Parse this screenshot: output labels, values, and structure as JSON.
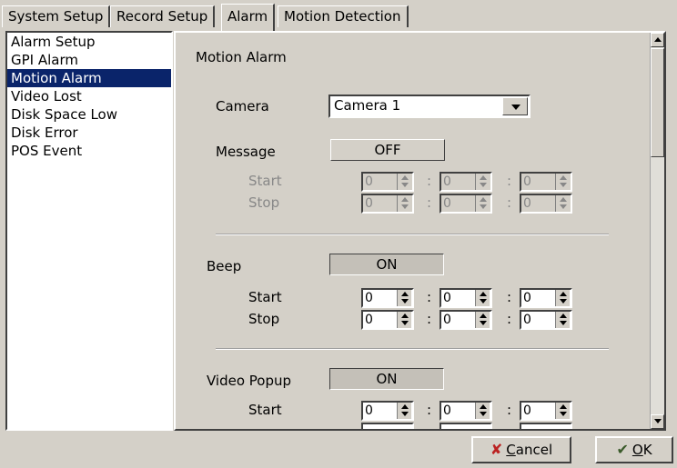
{
  "tabs": [
    {
      "label": "System Setup"
    },
    {
      "label": "Record Setup"
    },
    {
      "label": "Alarm"
    },
    {
      "label": "Motion Detection"
    }
  ],
  "sidebar": {
    "items": [
      {
        "label": "Alarm Setup"
      },
      {
        "label": "GPI Alarm"
      },
      {
        "label": "Motion Alarm"
      },
      {
        "label": "Video Lost"
      },
      {
        "label": "Disk Space Low"
      },
      {
        "label": "Disk Error"
      },
      {
        "label": "POS Event"
      }
    ],
    "selected": "Motion Alarm"
  },
  "main": {
    "title": "Motion Alarm",
    "camera_label": "Camera",
    "camera_value": "Camera 1",
    "message": {
      "label": "Message",
      "state": "OFF",
      "start_label": "Start",
      "stop_label": "Stop",
      "start": [
        "0",
        "0",
        "0"
      ],
      "stop": [
        "0",
        "0",
        "0"
      ]
    },
    "beep": {
      "label": "Beep",
      "state": "ON",
      "start_label": "Start",
      "stop_label": "Stop",
      "start": [
        "0",
        "0",
        "0"
      ],
      "stop": [
        "0",
        "0",
        "0"
      ]
    },
    "video_popup": {
      "label": "Video Popup",
      "state": "ON",
      "start_label": "Start",
      "start": [
        "0",
        "0",
        "0"
      ]
    },
    "colon": ":"
  },
  "buttons": {
    "cancel_prefix": "",
    "cancel_mnemonic": "C",
    "cancel_rest": "ancel",
    "ok_mnemonic": "O",
    "ok_rest": "K"
  },
  "colors": {
    "selected_bg": "#0a246a",
    "window_bg": "#d4d0c8"
  }
}
